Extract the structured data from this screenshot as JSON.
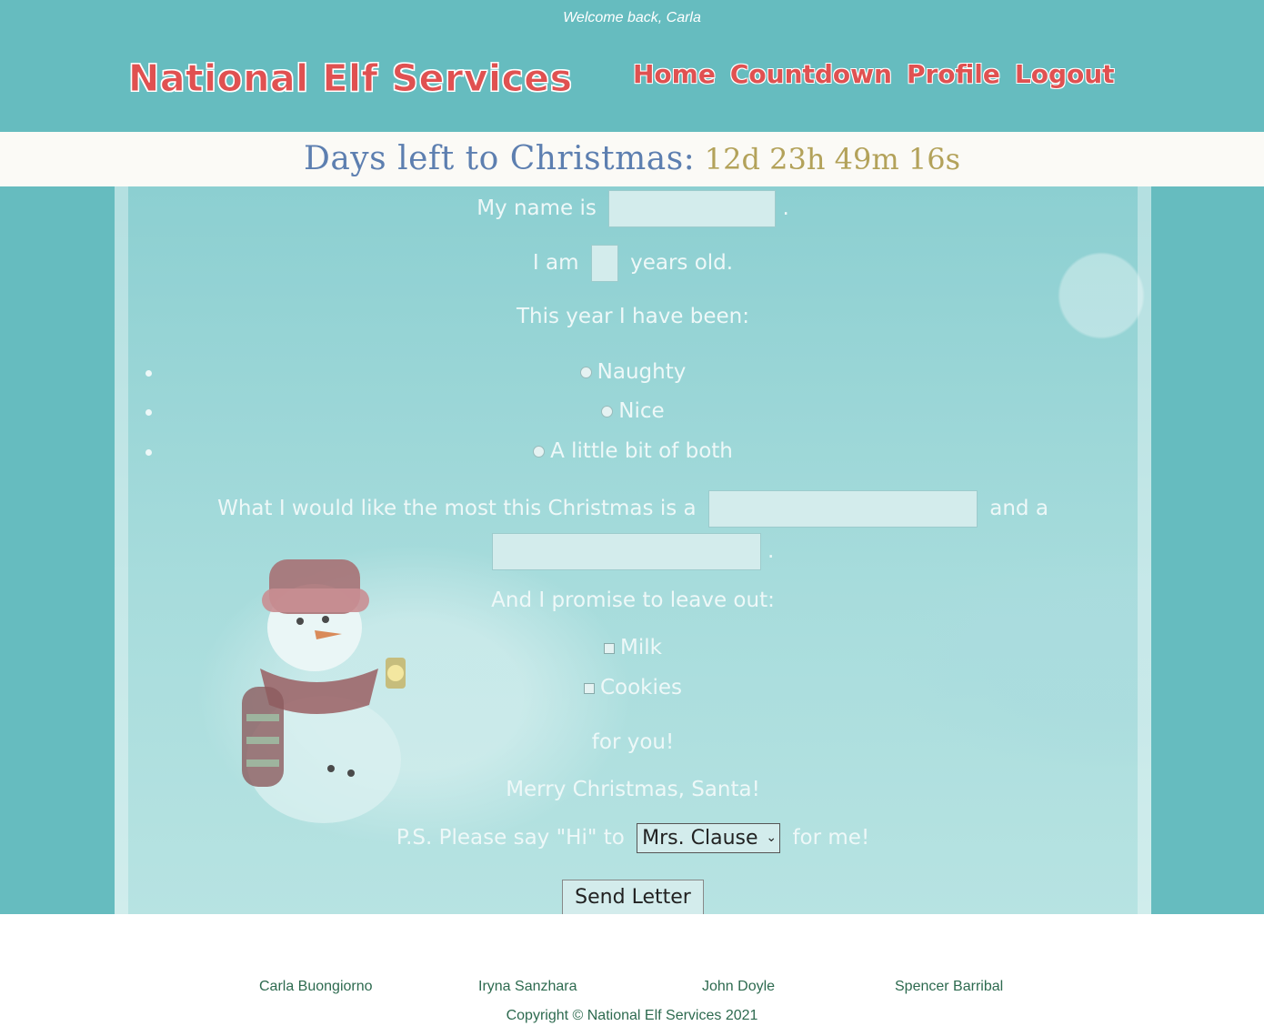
{
  "header": {
    "welcome": "Welcome back, Carla",
    "brand": "National Elf Services",
    "nav": [
      "Home",
      "Countdown",
      "Profile",
      "Logout"
    ]
  },
  "countdown": {
    "label": "Days left to Christmas:",
    "value": "12d 23h 49m 16s"
  },
  "letter": {
    "name_before": "My name is",
    "name_after": ".",
    "age_before": "I am",
    "age_after": "years old.",
    "behavior_prompt": "This year I have been:",
    "behavior_options": [
      "Naughty",
      "Nice",
      "A little bit of both"
    ],
    "wish_before": "What I would like the most this Christmas is a",
    "wish_middle": "and a",
    "wish_after": ".",
    "leave_out_prompt": "And I promise to leave out:",
    "leave_out_options": [
      "Milk",
      "Cookies"
    ],
    "for_you": "for you!",
    "closing": "Merry Christmas, Santa!",
    "ps_before": "P.S. Please say \"Hi\" to",
    "ps_selected": "Mrs. Clause",
    "ps_after": "for me!",
    "send_button": "Send Letter"
  },
  "footer": {
    "credits": [
      "Carla Buongiorno",
      "Iryna Sanzhara",
      "John Doyle",
      "Spencer Barribal"
    ],
    "copyright": "Copyright © National Elf Services 2021"
  },
  "colors": {
    "header_bg": "#66bcbf",
    "brand_red": "#e05151",
    "countdown_label": "#5d7fb0",
    "countdown_value": "#b3a25a",
    "footer_text": "#2d6a4f"
  }
}
